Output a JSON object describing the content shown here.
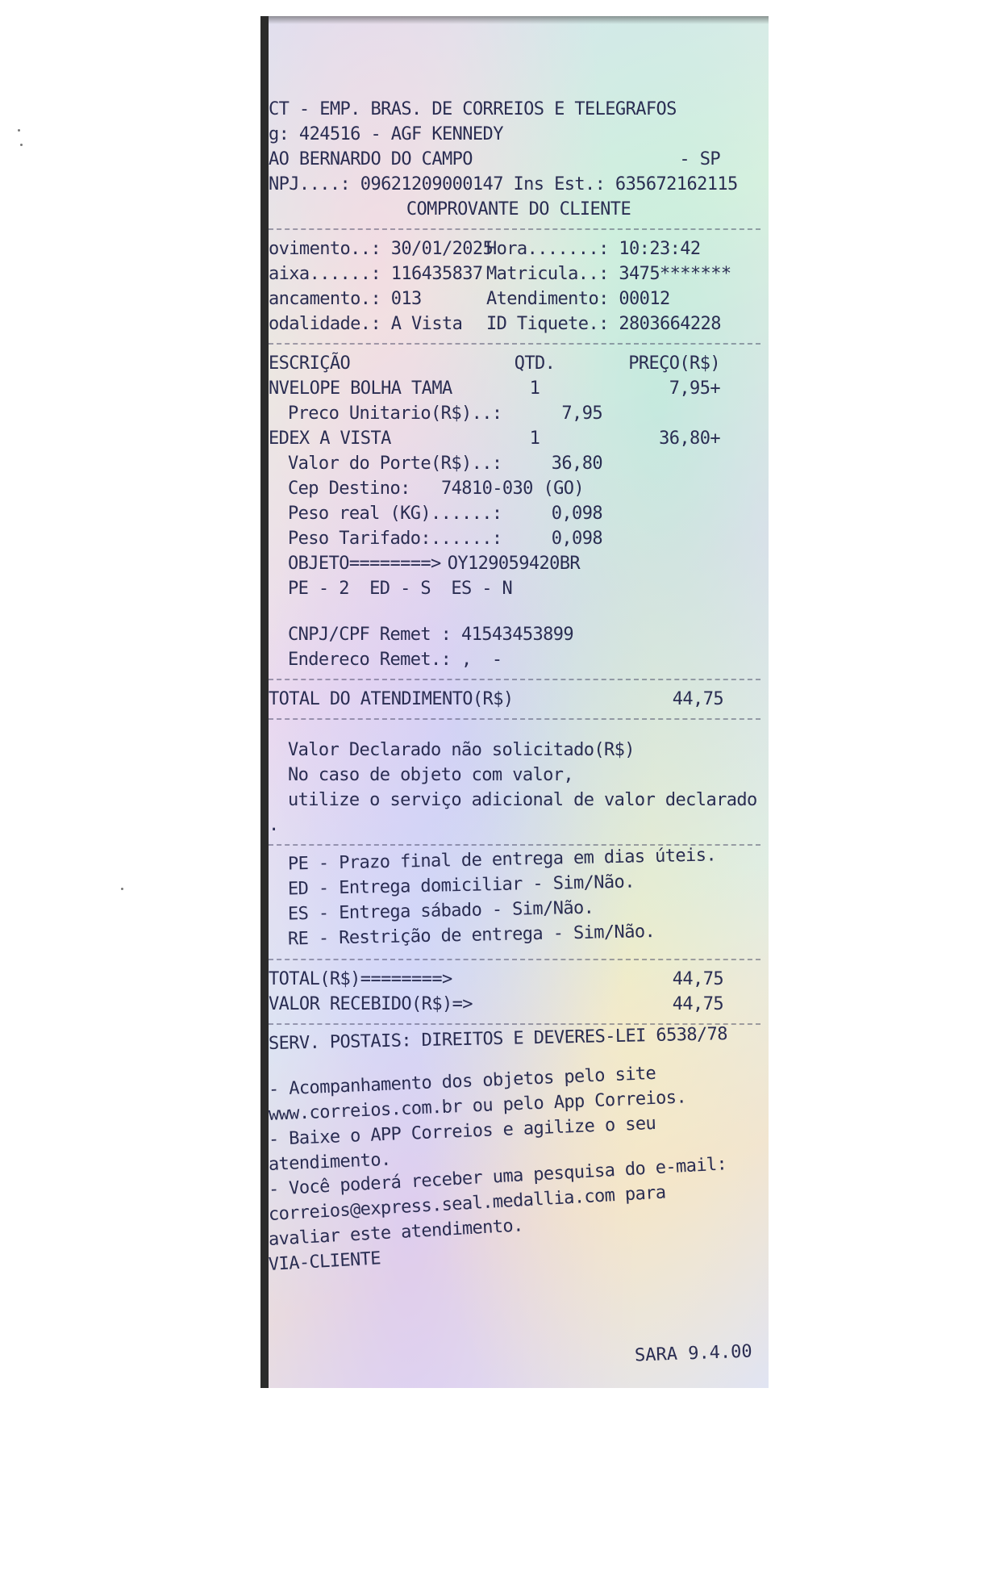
{
  "header": {
    "company": "CT - EMP. BRAS. DE CORREIOS E TELEGRAFOS",
    "agency": "g: 424516 - AGF KENNEDY",
    "city": "AO BERNARDO DO CAMPO",
    "state": "- SP",
    "cnpj": "NPJ....: 09621209000147 Ins Est.: 635672162115",
    "receipt_title": "COMPROVANTE DO CLIENTE"
  },
  "meta": {
    "movimento": "ovimento..: 30/01/2025",
    "hora": "Hora.......: 10:23:42",
    "caixa": "aixa......: 116435837",
    "matricula": "Matricula..: 3475*******",
    "lancamento": "ancamento.: 013",
    "atendimento": "Atendimento: 00012",
    "modalidade": "odalidade.: A Vista",
    "tiquete": "ID Tiquete.: 2803664228"
  },
  "items_header": {
    "descricao": "ESCRIÇÃO",
    "qtd": "QTD.",
    "preco": "PREÇO(R$)"
  },
  "items": [
    {
      "name": "NVELOPE BOLHA TAMA",
      "qty": "1",
      "price": "7,95+",
      "details": [
        {
          "label": "Preco Unitario(R$)..:",
          "value": "7,95"
        }
      ]
    },
    {
      "name": "EDEX A VISTA",
      "qty": "1",
      "price": "36,80+",
      "details": [
        {
          "label": "Valor do Porte(R$)..:",
          "value": "36,80"
        },
        {
          "label": "Cep Destino:",
          "value": "74810-030 (GO)"
        },
        {
          "label": "Peso real (KG)......:",
          "value": "0,098"
        },
        {
          "label": "Peso Tarifado:......:",
          "value": "0,098"
        },
        {
          "label": "OBJETO========>",
          "value": "OY129059420BR"
        },
        {
          "label": "PE - 2  ED - S  ES - N",
          "value": ""
        }
      ]
    }
  ],
  "sender": {
    "cnpj": "CNPJ/CPF Remet : 41543453899",
    "endereco": "Endereco Remet.: ,  -"
  },
  "total_atendimento": {
    "label": "TOTAL DO ATENDIMENTO(R$)",
    "value": "44,75"
  },
  "valor_declarado": [
    "Valor Declarado não solicitado(R$)",
    "No caso de objeto com valor,",
    "utilize o serviço adicional de valor declarado",
    "."
  ],
  "legend": [
    "PE - Prazo final de entrega em dias úteis.",
    "ED - Entrega domiciliar - Sim/Não.",
    "ES - Entrega sábado - Sim/Não.",
    "RE - Restrição de entrega - Sim/Não."
  ],
  "totals": {
    "total_label": "TOTAL(R$)========>",
    "total_value": "44,75",
    "recebido_label": "VALOR RECEBIDO(R$)=>",
    "recebido_value": "44,75"
  },
  "serv_postais": "SERV. POSTAIS: DIREITOS E DEVERES-LEI 6538/78",
  "footer_notes": [
    "- Acompanhamento dos objetos pelo site",
    "www.correios.com.br ou pelo App Correios.",
    "- Baixe o APP Correios e agilize o seu",
    "atendimento.",
    "- Você poderá receber uma pesquisa do e-mail:",
    "correios@express.seal.medallia.com para",
    "avaliar este atendimento.",
    "VIA-CLIENTE"
  ],
  "version": "SARA 9.4.00"
}
